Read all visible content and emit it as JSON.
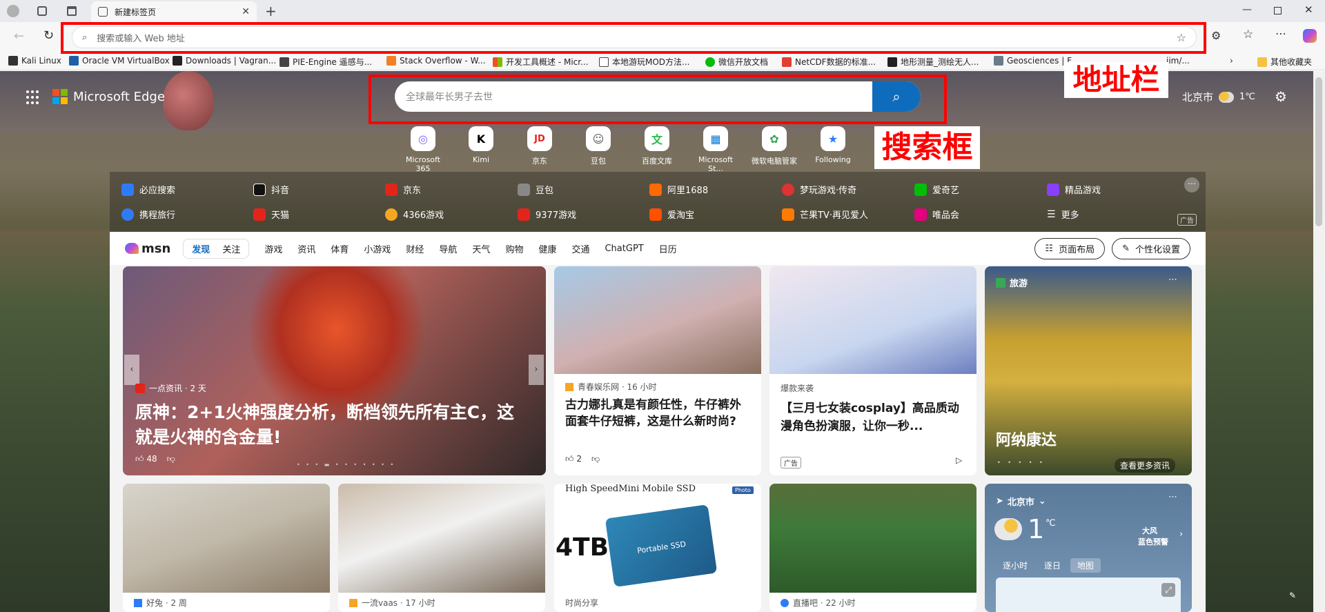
{
  "tab": {
    "title": "新建标签页"
  },
  "address": {
    "placeholder": "搜索或输入 Web 地址"
  },
  "bookmarks": [
    "Kali Linux",
    "Oracle VM VirtualBox",
    "Downloads | Vagran...",
    "PIE-Engine 遥感与...",
    "Stack Overflow - W...",
    "开发工具概述 - Micr...",
    "本地游玩MOD方法...",
    "微信开放文档",
    "NetCDF数据的标准...",
    "地形测量_测绘无人...",
    "Geosciences | F",
    "jim/...",
    "其他收藏夹"
  ],
  "annotations": {
    "address_bar": "地址栏",
    "search_box": "搜索框"
  },
  "edge": {
    "brand": "Microsoft Edge",
    "location": "北京市",
    "temp": "1℃"
  },
  "search": {
    "placeholder": "全球最年长男子去世"
  },
  "apps": [
    {
      "label": "Microsoft 365",
      "glyph": "◎",
      "color": "#7b61ff"
    },
    {
      "label": "Kimi",
      "glyph": "K",
      "color": "#000"
    },
    {
      "label": "京东",
      "glyph": "JD",
      "color": "#e1251b"
    },
    {
      "label": "豆包",
      "glyph": "☺",
      "color": "#555"
    },
    {
      "label": "百度文库",
      "glyph": "文",
      "color": "#2db84d"
    },
    {
      "label": "Microsoft St...",
      "glyph": "▦",
      "color": "#0078d4"
    },
    {
      "label": "微软电脑管家",
      "glyph": "✿",
      "color": "#3aa757"
    },
    {
      "label": "Following",
      "glyph": "★",
      "color": "#2f7bf5"
    }
  ],
  "quicklinks": [
    {
      "label": "必应搜索",
      "color": "#2f7bf5"
    },
    {
      "label": "抖音",
      "color": "#111"
    },
    {
      "label": "京东",
      "color": "#e1251b"
    },
    {
      "label": "豆包",
      "color": "#888"
    },
    {
      "label": "阿里1688",
      "color": "#ff6a00"
    },
    {
      "label": "梦玩游戏·传奇",
      "color": "#d33"
    },
    {
      "label": "爱奇艺",
      "color": "#00be06"
    },
    {
      "label": "精品游戏",
      "color": "#8a3ffc"
    },
    {
      "label": "携程旅行",
      "color": "#2f7bf5"
    },
    {
      "label": "天猫",
      "color": "#e1251b"
    },
    {
      "label": "4366游戏",
      "color": "#f5a623"
    },
    {
      "label": "9377游戏",
      "color": "#e1251b"
    },
    {
      "label": "爱淘宝",
      "color": "#ff5000"
    },
    {
      "label": "芒果TV·再见爱人",
      "color": "#ff7a00"
    },
    {
      "label": "唯品会",
      "color": "#e5007f"
    },
    {
      "label": "更多",
      "color": "#fff"
    }
  ],
  "ad_label": "广告",
  "msn": {
    "logo": "msn",
    "tabs": [
      "发现",
      "关注"
    ],
    "nav": [
      "游戏",
      "资讯",
      "体育",
      "小游戏",
      "财经",
      "导航",
      "天气",
      "购物",
      "健康",
      "交通",
      "ChatGPT",
      "日历"
    ],
    "layout_btn": "页面布局",
    "personalize_btn": "个性化设置"
  },
  "cards": {
    "hero": {
      "source": "一点资讯 · 2 天",
      "title": "原神：2+1火神强度分析，断档领先所有主C，这就是火神的含金量!",
      "likes": "48"
    },
    "c2": {
      "source": "青春娱乐网 · 16 小时",
      "title": "古力娜扎真是有颜任性，牛仔裤外面套牛仔短裤，这是什么新时尚?",
      "likes": "2"
    },
    "c3": {
      "source": "爆款来袭",
      "title": "【三月七女装cosplay】高品质动漫角色扮演服，让你一秒...",
      "ad": "广告"
    },
    "c4": {
      "category": "旅游",
      "title": "阿纳康达",
      "more": "查看更多资讯"
    },
    "row2": [
      {
        "source": "好兔 · 2 周"
      },
      {
        "source": "一流vaas · 17 小时"
      },
      {
        "source": "时尚分享",
        "ad_text": "High SpeedMini Mobile SSD",
        "cap": "4TB",
        "product": "Portable SSD",
        "badge": "Photo"
      },
      {
        "source": "直播吧 · 22 小时"
      }
    ],
    "weather": {
      "city": "北京市",
      "temp": "1",
      "unit": "℃",
      "alert1": "大风",
      "alert2": "蓝色预警",
      "tabs": [
        "逐小时",
        "逐日",
        "地图"
      ]
    }
  }
}
